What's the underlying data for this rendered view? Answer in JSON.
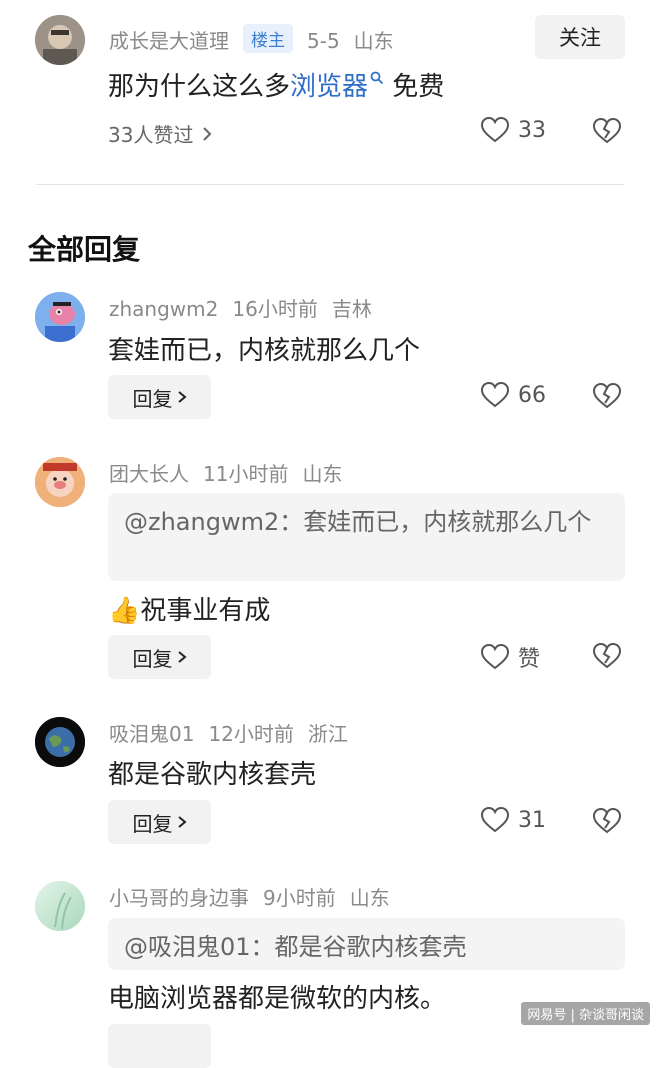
{
  "top_comment": {
    "username": "成长是大道理",
    "badge": "楼主",
    "date": "5-5",
    "location": "山东",
    "follow_label": "关注",
    "text_before": "那为什么这么多",
    "link_text": "浏览器",
    "text_after": " 免费",
    "likes_summary": "33人赞过",
    "like_count": "33"
  },
  "section_title": "全部回复",
  "replies": [
    {
      "username": "zhangwm2",
      "time": "16小时前",
      "location": "吉林",
      "text": "套娃而已，内核就那么几个",
      "reply_label": "回复",
      "like_count": "66"
    },
    {
      "username": "团大长人",
      "time": "11小时前",
      "location": "山东",
      "quote": "@zhangwm2：套娃而已，内核就那么几个",
      "emoji": "👍",
      "text": "祝事业有成",
      "reply_label": "回复",
      "like_count": "赞"
    },
    {
      "username": "吸泪鬼01",
      "time": "12小时前",
      "location": "浙江",
      "text": "都是谷歌内核套壳",
      "reply_label": "回复",
      "like_count": "31"
    },
    {
      "username": "小马哥的身边事",
      "time": "9小时前",
      "location": "山东",
      "quote": "@吸泪鬼01：都是谷歌内核套壳",
      "text": "电脑浏览器都是微软的内核。"
    }
  ],
  "watermark": "网易号 | 杂谈哥闲谈",
  "colors": {
    "link": "#2f6fc9",
    "badge_bg": "#e8f1fb",
    "badge_text": "#3d7fd1",
    "meta": "#8a8a8a"
  }
}
